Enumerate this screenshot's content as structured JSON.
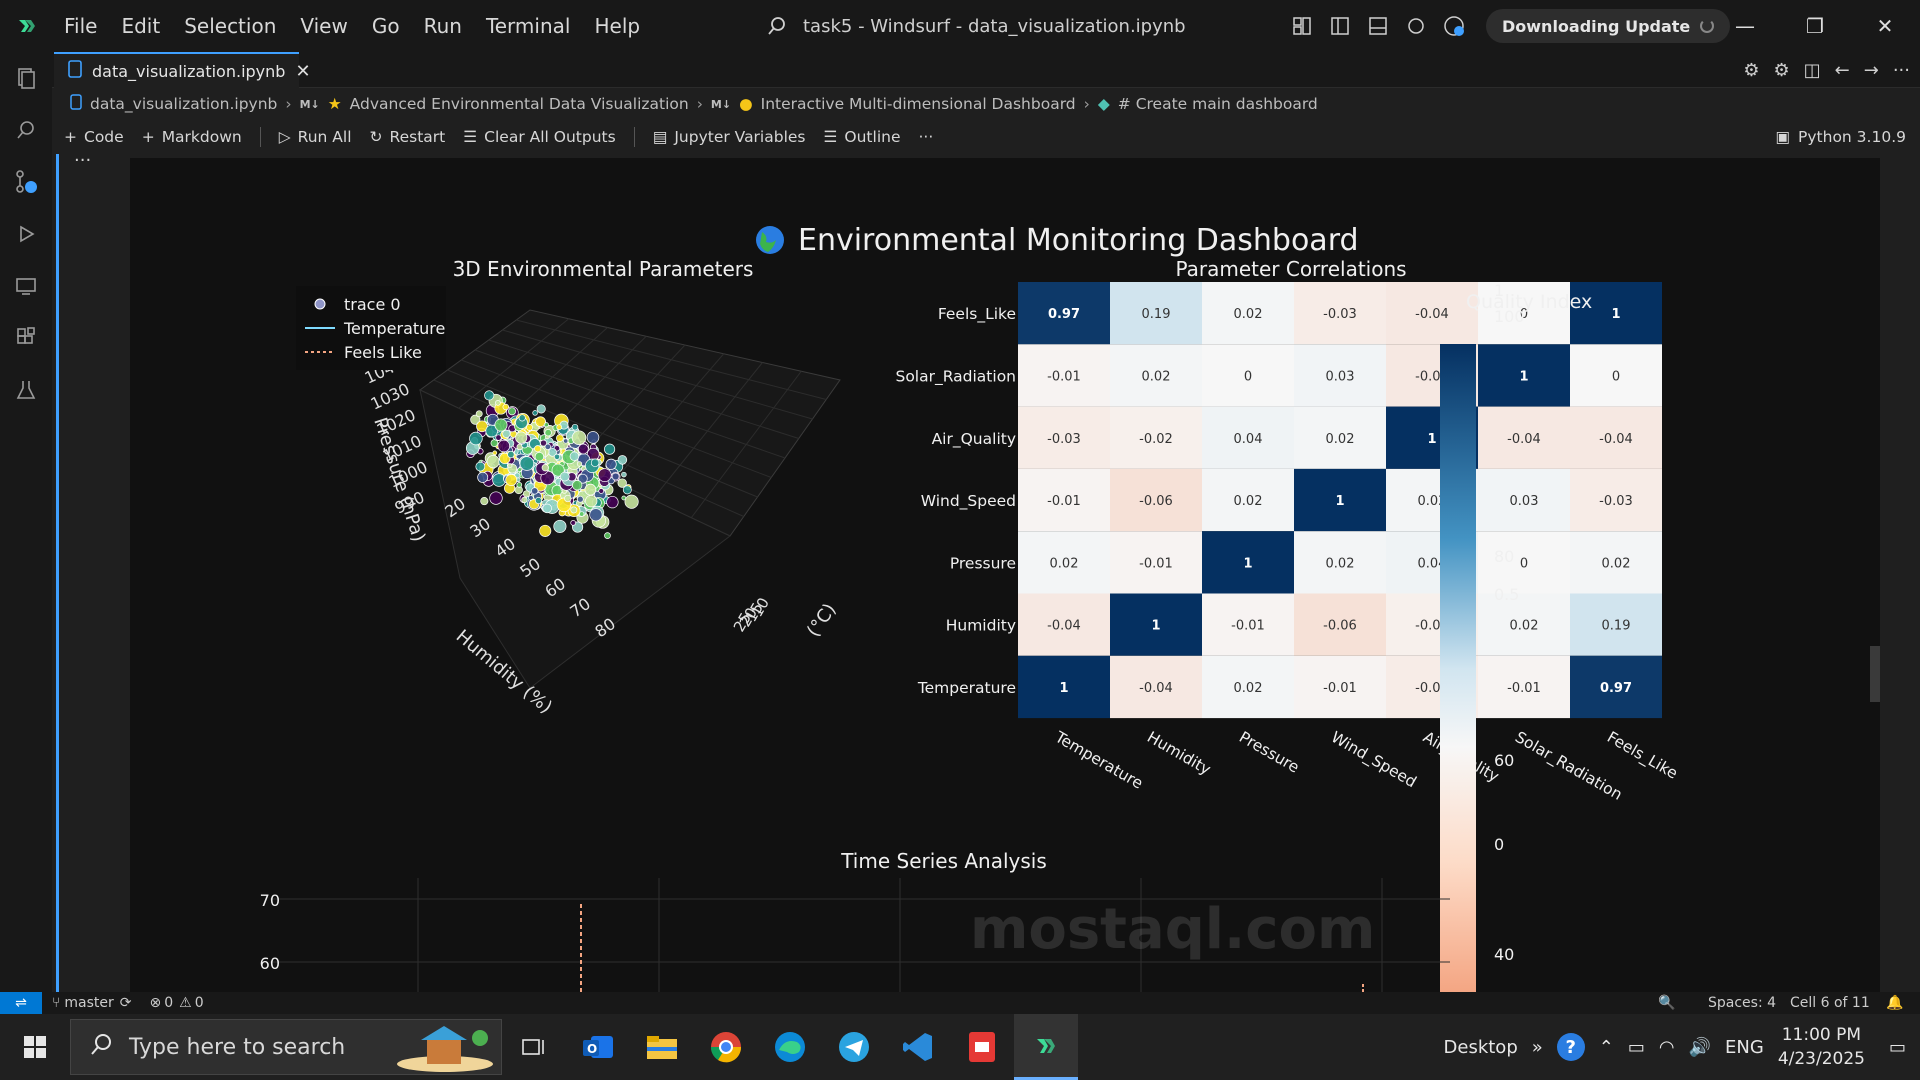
{
  "menu": [
    "File",
    "Edit",
    "Selection",
    "View",
    "Go",
    "Run",
    "Terminal",
    "Help"
  ],
  "window_title": "task5 - Windsurf - data_visualization.ipynb",
  "update_label": "Downloading Update",
  "tab": {
    "name": "data_visualization.ipynb",
    "close": "✕"
  },
  "breadcrumb": {
    "file": "data_visualization.ipynb",
    "md_badge": "M↓",
    "section1": "Advanced Environmental Data Visualization",
    "section2": "Interactive Multi-dimensional Dashboard",
    "section3": "# Create main dashboard"
  },
  "toolbar": {
    "code": "Code",
    "markdown": "Markdown",
    "run_all": "Run All",
    "restart": "Restart",
    "clear_outputs": "Clear All Outputs",
    "variables": "Jupyter Variables",
    "outline": "Outline",
    "more": "···",
    "kernel": "Python 3.10.9"
  },
  "cell_more": "···",
  "dashboard": {
    "title": "Environmental Monitoring Dashboard",
    "title_icon": "globe-icon"
  },
  "chart_data": [
    {
      "type": "scatter",
      "title": "3D Environmental Parameters",
      "legend": [
        "trace 0",
        "Temperature",
        "Feels Like"
      ],
      "legend_placement": "top-left",
      "axes": {
        "z": {
          "label": "Pressure (hPa)",
          "ticks": [
            "990",
            "1000",
            "1010",
            "1020",
            "1030",
            "1040"
          ]
        },
        "y": {
          "label": "Humidity (%)",
          "ticks": [
            "20",
            "30",
            "40",
            "50",
            "60",
            "70",
            "80"
          ]
        },
        "x": {
          "label": "(°C)",
          "ticks": [
            "10",
            "15",
            "20",
            "25"
          ]
        }
      },
      "note": "dense point cloud centred near Humidity 50-60, Pressure ~1010"
    },
    {
      "type": "heatmap",
      "title": "Parameter Correlations",
      "rows": [
        "Feels_Like",
        "Solar_Radiation",
        "Air_Quality",
        "Wind_Speed",
        "Pressure",
        "Humidity",
        "Temperature"
      ],
      "columns": [
        "Temperature",
        "Humidity",
        "Pressure",
        "Wind_Speed",
        "Air_Quality",
        "Solar_Radiation",
        "Feels_Like"
      ],
      "values": [
        [
          "0.97",
          "0.19",
          "0.02",
          "-0.03",
          "-0.04",
          "0",
          "1"
        ],
        [
          "-0.01",
          "0.02",
          "0",
          "0.03",
          "-0.04",
          "1",
          "0"
        ],
        [
          "-0.03",
          "-0.02",
          "0.04",
          "0.02",
          "1",
          "-0.04",
          "-0.04"
        ],
        [
          "-0.01",
          "-0.06",
          "0.02",
          "1",
          "0.02",
          "0.03",
          "-0.03"
        ],
        [
          "0.02",
          "-0.01",
          "1",
          "0.02",
          "0.04",
          "0",
          "0.02"
        ],
        [
          "-0.04",
          "1",
          "-0.01",
          "-0.06",
          "-0.02",
          "0.02",
          "0.19"
        ],
        [
          "1",
          "-0.04",
          "0.02",
          "-0.01",
          "-0.03",
          "-0.01",
          "0.97"
        ]
      ],
      "colorscale": [
        "#f4a582",
        "#f7f7f7",
        "#92c5de",
        "#053061"
      ]
    },
    {
      "type": "colorbar",
      "title": "Quality Index",
      "ticks_right": [
        "100",
        "80",
        "60",
        "40"
      ],
      "ticks_corr": [
        "1",
        "0.5",
        "0"
      ]
    },
    {
      "type": "line",
      "title": "Time Series Analysis",
      "y_ticks": [
        "70",
        "60"
      ]
    }
  ],
  "statusbar": {
    "branch": "master",
    "errors": "0",
    "warnings": "0",
    "spaces": "Spaces: 4",
    "cell": "Cell 6 of 11"
  },
  "taskbar": {
    "search_placeholder": "Type here to search",
    "desktop": "Desktop",
    "lang": "ENG",
    "time": "11:00 PM",
    "date": "4/23/2025"
  },
  "watermark": "mostaql.com"
}
